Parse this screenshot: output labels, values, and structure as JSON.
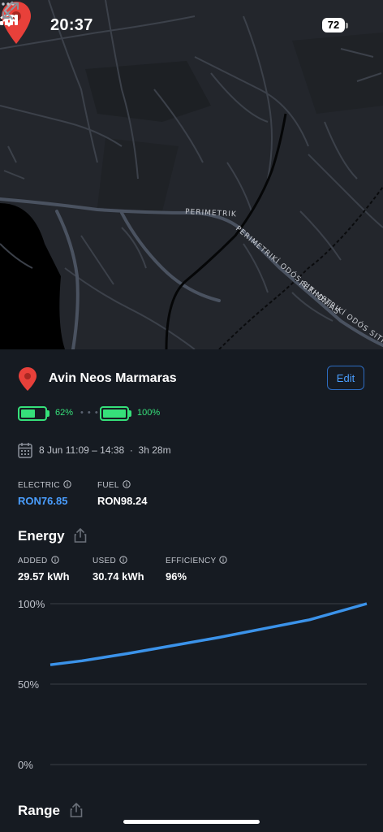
{
  "status_bar": {
    "time": "20:37",
    "battery_level": "72",
    "signal_icon": "cellular-signal-icon",
    "wifi_icon": "wifi-icon"
  },
  "map": {
    "road_label": "PERIMETRIKÍ ODÓS SITHONÍAS",
    "road_label_repeat": "PERIMETRIKÍ ODÓS SITHONÍAS",
    "road_label_short": "PERIMETRIK",
    "pin_color": "#e8403a"
  },
  "location": {
    "name": "Avin Neos Marmaras",
    "edit_label": "Edit"
  },
  "charge": {
    "start_pct": "62%",
    "start_level": 0.62,
    "end_pct": "100%",
    "end_level": 1.0,
    "separator": "• • •"
  },
  "session": {
    "date_range": "8 Jun 11:09 – 14:38",
    "separator": "·",
    "duration": "3h 28m"
  },
  "prices": {
    "electric_label": "ELECTRIC",
    "electric_value": "RON76.85",
    "fuel_label": "FUEL",
    "fuel_value": "RON98.24"
  },
  "energy": {
    "title": "Energy",
    "added_label": "ADDED",
    "added_value": "29.57 kWh",
    "used_label": "USED",
    "used_value": "30.74 kWh",
    "efficiency_label": "EFFICIENCY",
    "efficiency_value": "96%"
  },
  "range": {
    "title": "Range"
  },
  "colors": {
    "accent": "#4a9eff",
    "battery_green": "#36e07a",
    "background": "#161b22",
    "line": "#3b93ea"
  },
  "chart_data": {
    "type": "line",
    "x": [
      11.15,
      11.5,
      12.0,
      12.5,
      13.0,
      13.5,
      14.0,
      14.63
    ],
    "series": [
      {
        "values": [
          62,
          64.5,
          69,
          74,
          79,
          84.5,
          90,
          100
        ]
      }
    ],
    "ylim": [
      0,
      100
    ],
    "yticks": [
      "0%",
      "50%",
      "100%"
    ],
    "xlabel": "",
    "ylabel": "",
    "grid": true
  }
}
